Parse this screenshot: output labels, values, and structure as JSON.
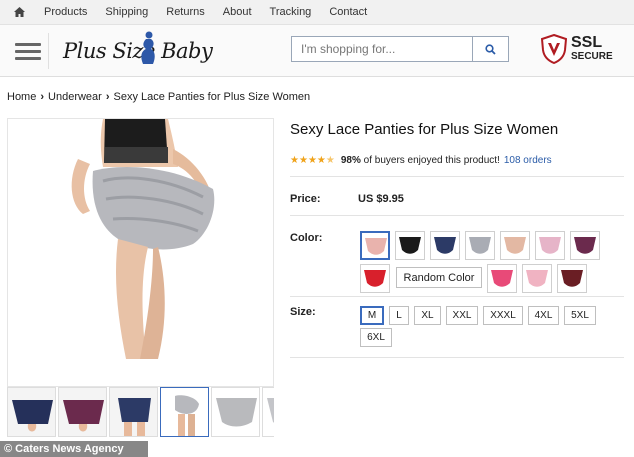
{
  "topnav": {
    "home_icon": "home-icon",
    "links": [
      "Products",
      "Shipping",
      "Returns",
      "About",
      "Tracking",
      "Contact"
    ]
  },
  "header": {
    "logo_text": "Plus Size Baby",
    "search_placeholder": "I'm shopping for...",
    "ssl_line1": "SSL",
    "ssl_line2": "SECURE"
  },
  "breadcrumb": [
    "Home",
    "Underwear",
    "Sexy Lace Panties for Plus Size Women"
  ],
  "product": {
    "title": "Sexy Lace Panties for Plus Size Women",
    "rating_stars": 4.5,
    "rating_pct": "98%",
    "rating_text": "of buyers enjoyed this product!",
    "orders": "108 orders",
    "price_label": "Price:",
    "price": "US $9.95",
    "color_label": "Color:",
    "colors": [
      "#e9b3ad",
      "#1a1a1a",
      "#2c3a66",
      "#a9acb4",
      "#e3b8a3",
      "#e6b4c8",
      "#6b2a4d",
      "#d8202c",
      "random",
      "#e84a78",
      "#f0b3c2",
      "#6a1e24"
    ],
    "random_color_label": "Random Color",
    "size_label": "Size:",
    "sizes": [
      "M",
      "L",
      "XL",
      "XXL",
      "XXXL",
      "4XL",
      "5XL",
      "6XL"
    ]
  },
  "accent_color": "#3a6bbd",
  "watermark": "© Caters News Agency"
}
